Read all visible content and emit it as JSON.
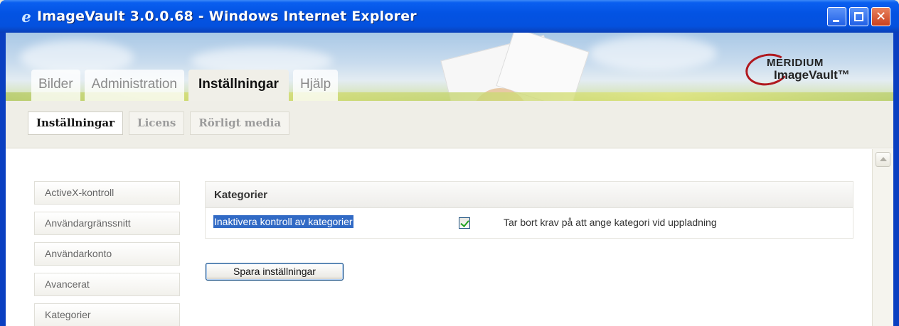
{
  "window": {
    "title": "ImageVault 3.0.0.68 - Windows Internet Explorer"
  },
  "logo": {
    "top": "MERIDIUM",
    "bottom": "ImageVault™"
  },
  "main_tabs": [
    {
      "label": "Bilder",
      "active": false
    },
    {
      "label": "Administration",
      "active": false
    },
    {
      "label": "Inställningar",
      "active": true
    },
    {
      "label": "Hjälp",
      "active": false
    }
  ],
  "sub_tabs": [
    {
      "label": "Inställningar",
      "active": true
    },
    {
      "label": "Licens",
      "active": false
    },
    {
      "label": "Rörligt media",
      "active": false
    }
  ],
  "side_menu": [
    {
      "label": "ActiveX-kontroll"
    },
    {
      "label": "Användargränssnitt"
    },
    {
      "label": "Användarkonto"
    },
    {
      "label": "Avancerat"
    },
    {
      "label": "Kategorier"
    }
  ],
  "panel": {
    "title": "Kategorier",
    "setting_label": "Inaktivera kontroll av kategorier",
    "setting_checked": true,
    "setting_description": "Tar bort krav på att ange kategori vid uppladning"
  },
  "save_button": "Spara inställningar"
}
